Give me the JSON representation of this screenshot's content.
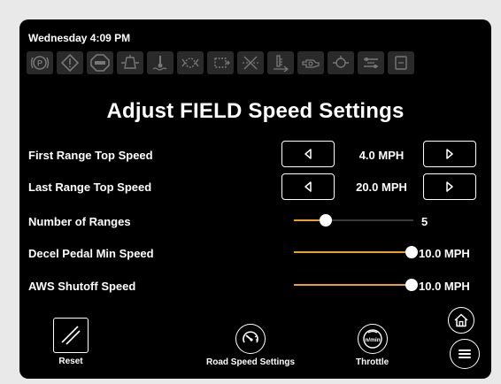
{
  "status": {
    "datetime": "Wednesday 4:09 PM"
  },
  "warnings": [
    {
      "icon": "parking-brake-icon"
    },
    {
      "icon": "general-warning-icon"
    },
    {
      "icon": "stop-icon"
    },
    {
      "icon": "hydraulic-filter-icon"
    },
    {
      "icon": "coolant-temp-icon"
    },
    {
      "icon": "transmission-icon"
    },
    {
      "icon": "transmission-filter-icon"
    },
    {
      "icon": "air-filter-icon"
    },
    {
      "icon": "hydraulic-oil-level-icon"
    },
    {
      "icon": "engine-oil-icon"
    },
    {
      "icon": "oil-pressure-icon"
    },
    {
      "icon": "battery-charge-icon"
    },
    {
      "icon": "fuel-icon"
    }
  ],
  "page": {
    "title": "Adjust FIELD Speed Settings"
  },
  "settings": {
    "first_range": {
      "label": "First Range Top Speed",
      "value": "4.0 MPH"
    },
    "last_range": {
      "label": "Last Range Top Speed",
      "value": "20.0 MPH"
    },
    "num_ranges": {
      "label": "Number of Ranges",
      "value": "5",
      "level": 0.27
    },
    "decel_pedal": {
      "label": "Decel Pedal Min Speed",
      "value": "10.0 MPH",
      "level": 1.0
    },
    "aws_shutoff": {
      "label": "AWS Shutoff Speed",
      "value": "10.0 MPH",
      "level": 1.0
    }
  },
  "bottom": {
    "reset_label": "Reset",
    "road_label": "Road Speed Settings",
    "throttle_label": "Throttle",
    "throttle_icon_text": "n/min"
  },
  "colors": {
    "accent": "#f0a020",
    "background": "#000000",
    "text": "#ffffff",
    "warning_bg": "#2a2a2a"
  }
}
